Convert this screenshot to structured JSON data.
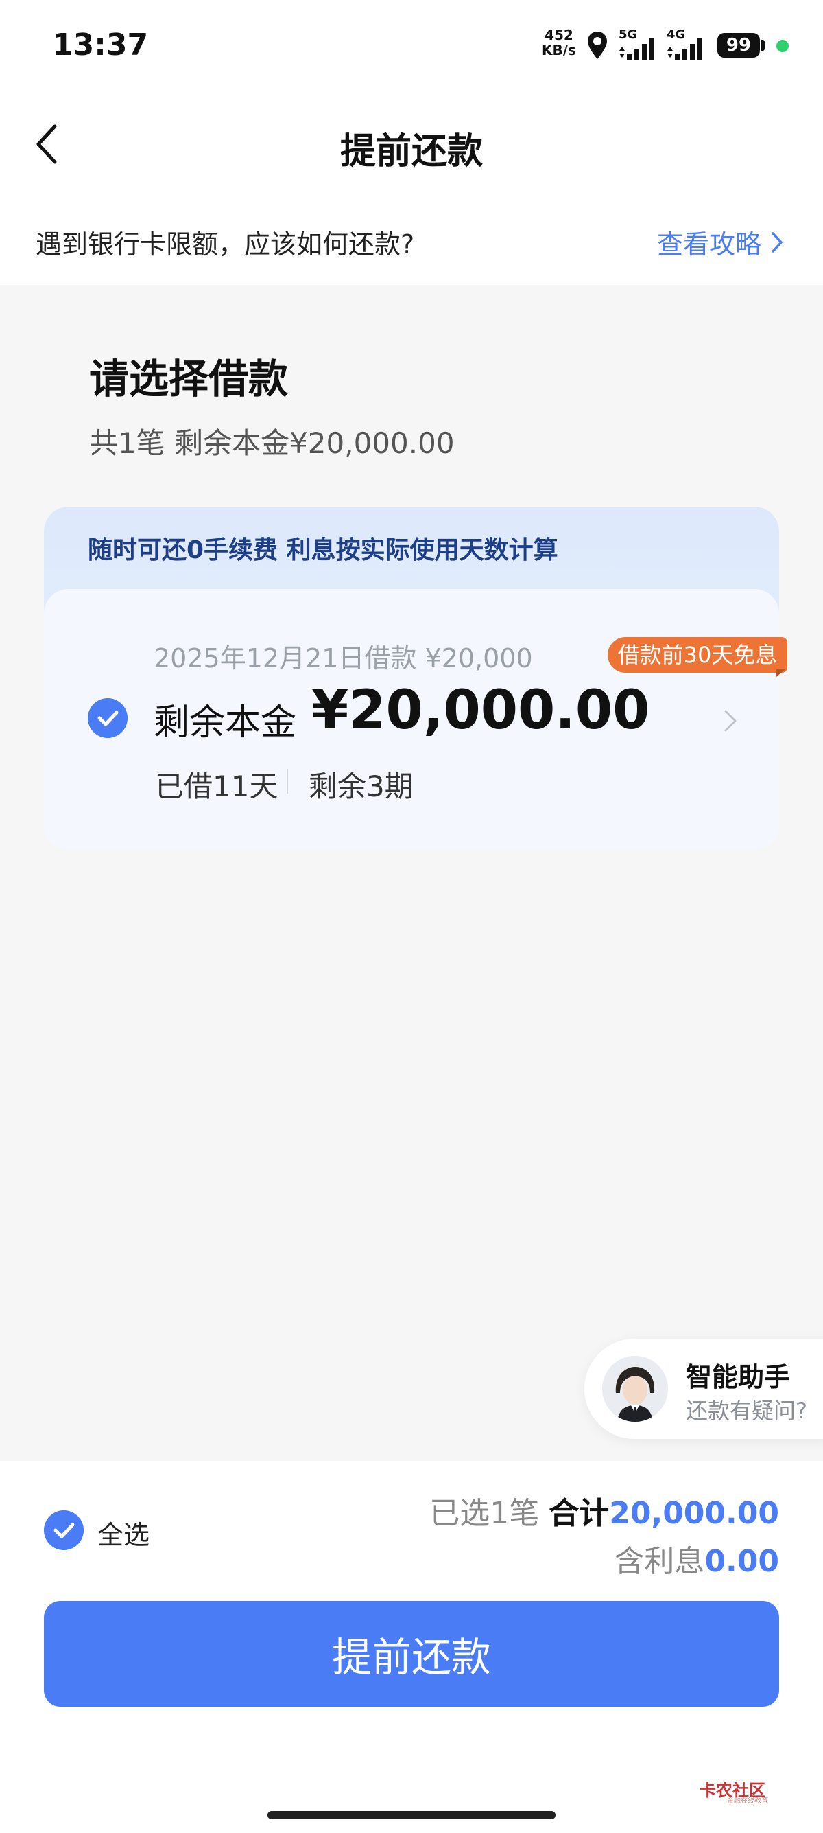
{
  "status_bar": {
    "time": "13:37",
    "net_speed_value": "452",
    "net_speed_unit": "KB/s",
    "signal_1_label": "5G",
    "signal_2_label": "4G",
    "battery": "99"
  },
  "header": {
    "title": "提前还款"
  },
  "tip": {
    "text": "遇到银行卡限额，应该如何还款?",
    "link": "查看攻略"
  },
  "section": {
    "title": "请选择借款",
    "subtitle": "共1笔 剩余本金¥20,000.00"
  },
  "loan_card": {
    "banner": "随时可还0手续费 利息按实际使用天数计算",
    "loan_info": "2025年12月21日借款 ¥20,000",
    "badge": "借款前30天免息",
    "remaining_label": "剩余本金",
    "remaining_amount": "¥20,000.00",
    "days_borrowed": "已借11天",
    "remaining_periods": "剩余3期",
    "selected": true
  },
  "assistant": {
    "title": "智能助手",
    "subtitle": "还款有疑问?"
  },
  "footer": {
    "select_all_label": "全选",
    "selected_count": "已选1笔",
    "total_label": "合计",
    "total_amount": "20,000.00",
    "interest_label": "含利息",
    "interest_amount": "0.00",
    "submit_label": "提前还款"
  },
  "watermark": {
    "text": "卡农社区",
    "sub": "金融在线教育"
  },
  "colors": {
    "accent": "#4a7cf6",
    "badge": "#ed7434",
    "banner_text": "#1d3f87"
  }
}
